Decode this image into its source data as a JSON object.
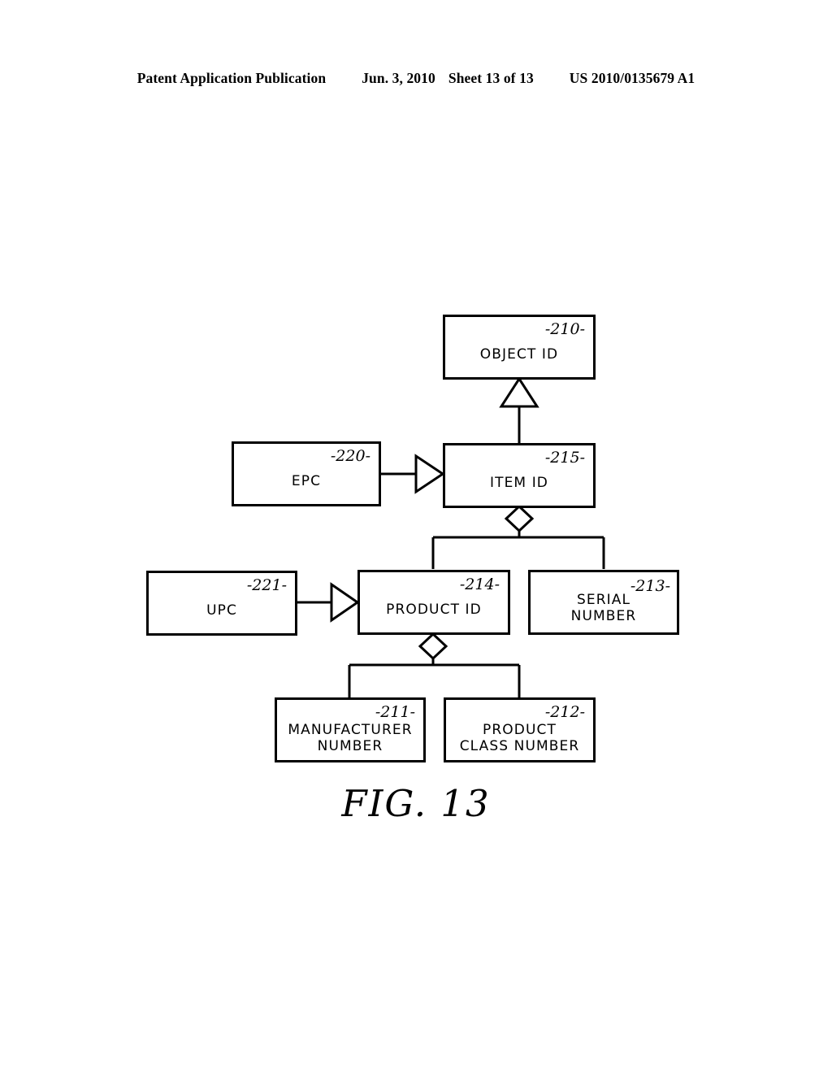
{
  "header": {
    "publication": "Patent Application Publication",
    "date": "Jun. 3, 2010",
    "sheet": "Sheet 13 of 13",
    "number": "US 2010/0135679 A1"
  },
  "figure": {
    "caption": "FIG. 13",
    "colors": {
      "line": "#000000",
      "background": "#ffffff"
    }
  },
  "diagram": {
    "type": "uml-class-hierarchy",
    "nodes": [
      {
        "id": "object-id",
        "label": "OBJECT ID",
        "ref": "-210-"
      },
      {
        "id": "item-id",
        "label": "ITEM ID",
        "ref": "-215-"
      },
      {
        "id": "epc",
        "label": "EPC",
        "ref": "-220-"
      },
      {
        "id": "upc",
        "label": "UPC",
        "ref": "-221-"
      },
      {
        "id": "product-id",
        "label": "PRODUCT ID",
        "ref": "-214-"
      },
      {
        "id": "serial-number",
        "label": "SERIAL\nNUMBER",
        "ref": "-213-"
      },
      {
        "id": "manufacturer-number",
        "label": "MANUFACTURER\nNUMBER",
        "ref": "-211-"
      },
      {
        "id": "product-class-number",
        "label": "PRODUCT\nCLASS NUMBER",
        "ref": "-212-"
      }
    ],
    "edges": [
      {
        "from": "item-id",
        "to": "object-id",
        "kind": "generalization"
      },
      {
        "from": "epc",
        "to": "item-id",
        "kind": "generalization"
      },
      {
        "from": "upc",
        "to": "product-id",
        "kind": "generalization"
      },
      {
        "from": "item-id",
        "to": "product-id",
        "kind": "aggregation"
      },
      {
        "from": "item-id",
        "to": "serial-number",
        "kind": "aggregation"
      },
      {
        "from": "product-id",
        "to": "manufacturer-number",
        "kind": "aggregation"
      },
      {
        "from": "product-id",
        "to": "product-class-number",
        "kind": "aggregation"
      }
    ]
  }
}
